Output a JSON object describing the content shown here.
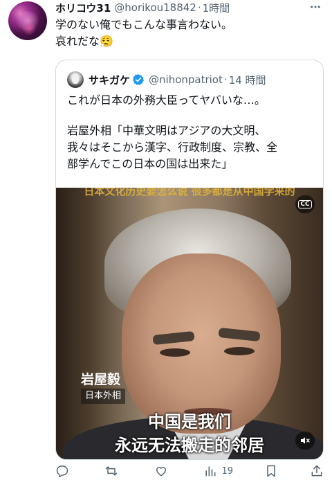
{
  "tweet": {
    "display_name": "ホリコウ31",
    "handle": "@horikou18842",
    "separator": "·",
    "time": "1時間",
    "text_lines": [
      "学のない俺でもこんな事言わない。",
      "哀れだな😮‍💨"
    ]
  },
  "quote": {
    "display_name": "サキガケ",
    "handle": "@nihonpatriot",
    "separator": "·",
    "time": "14 時間",
    "text_lines": [
      "これが日本の外務大臣ってヤバいな…。",
      "",
      "岩屋外相「中華文明はアジアの大文明、",
      "我々はそこから漢字、行政制度、宗教、全",
      "部学んでこの日本の国は出来た」"
    ],
    "video": {
      "top_subtitle": "日本文化历史要怎么说 很多都是从中国学来的",
      "cc_label": "CC",
      "name_caption": "岩屋毅",
      "role_caption": "日本外相",
      "subtitle_line1": "中国是我们",
      "subtitle_line2": "永远无法搬走的邻居"
    }
  },
  "actions": {
    "reply_count": "",
    "retweet_count": "",
    "like_count": "",
    "views_count": "19"
  },
  "icons": [
    "more-icon",
    "verified-icon",
    "cc-icon",
    "mute-icon",
    "reply-icon",
    "retweet-icon",
    "like-icon",
    "views-icon",
    "bookmark-icon",
    "share-icon"
  ],
  "colors": {
    "text": "#0f1419",
    "secondary": "#536471",
    "border": "#cfd9de",
    "verified": "#1d9bf0"
  }
}
